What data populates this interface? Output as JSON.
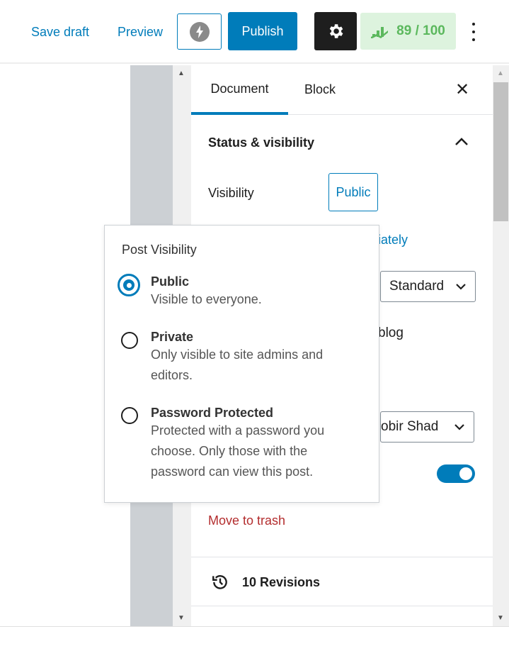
{
  "header": {
    "save_draft": "Save draft",
    "preview": "Preview",
    "publish": "Publish",
    "score": "89 / 100",
    "colors": {
      "accent": "#007cba",
      "score_bg": "#ddf3de",
      "score_text": "#5bb85d"
    }
  },
  "sidebar": {
    "tabs": [
      {
        "label": "Document",
        "active": true
      },
      {
        "label": "Block",
        "active": false
      }
    ],
    "status_title": "Status & visibility",
    "visibility_label": "Visibility",
    "visibility_value": "Public",
    "publish_fragment": "iately",
    "format_value": "Standard",
    "sticky_fragment": "blog",
    "author_fragment": "obir Shad",
    "pending_toggle": true,
    "trash": "Move to trash",
    "revisions": "10 Revisions"
  },
  "popover": {
    "title": "Post Visibility",
    "options": [
      {
        "label": "Public",
        "desc": "Visible to everyone.",
        "selected": true
      },
      {
        "label": "Private",
        "desc": "Only visible to site admins and editors.",
        "selected": false
      },
      {
        "label": "Password Protected",
        "desc": "Protected with a password you choose. Only those with the password can view this post.",
        "selected": false
      }
    ]
  }
}
